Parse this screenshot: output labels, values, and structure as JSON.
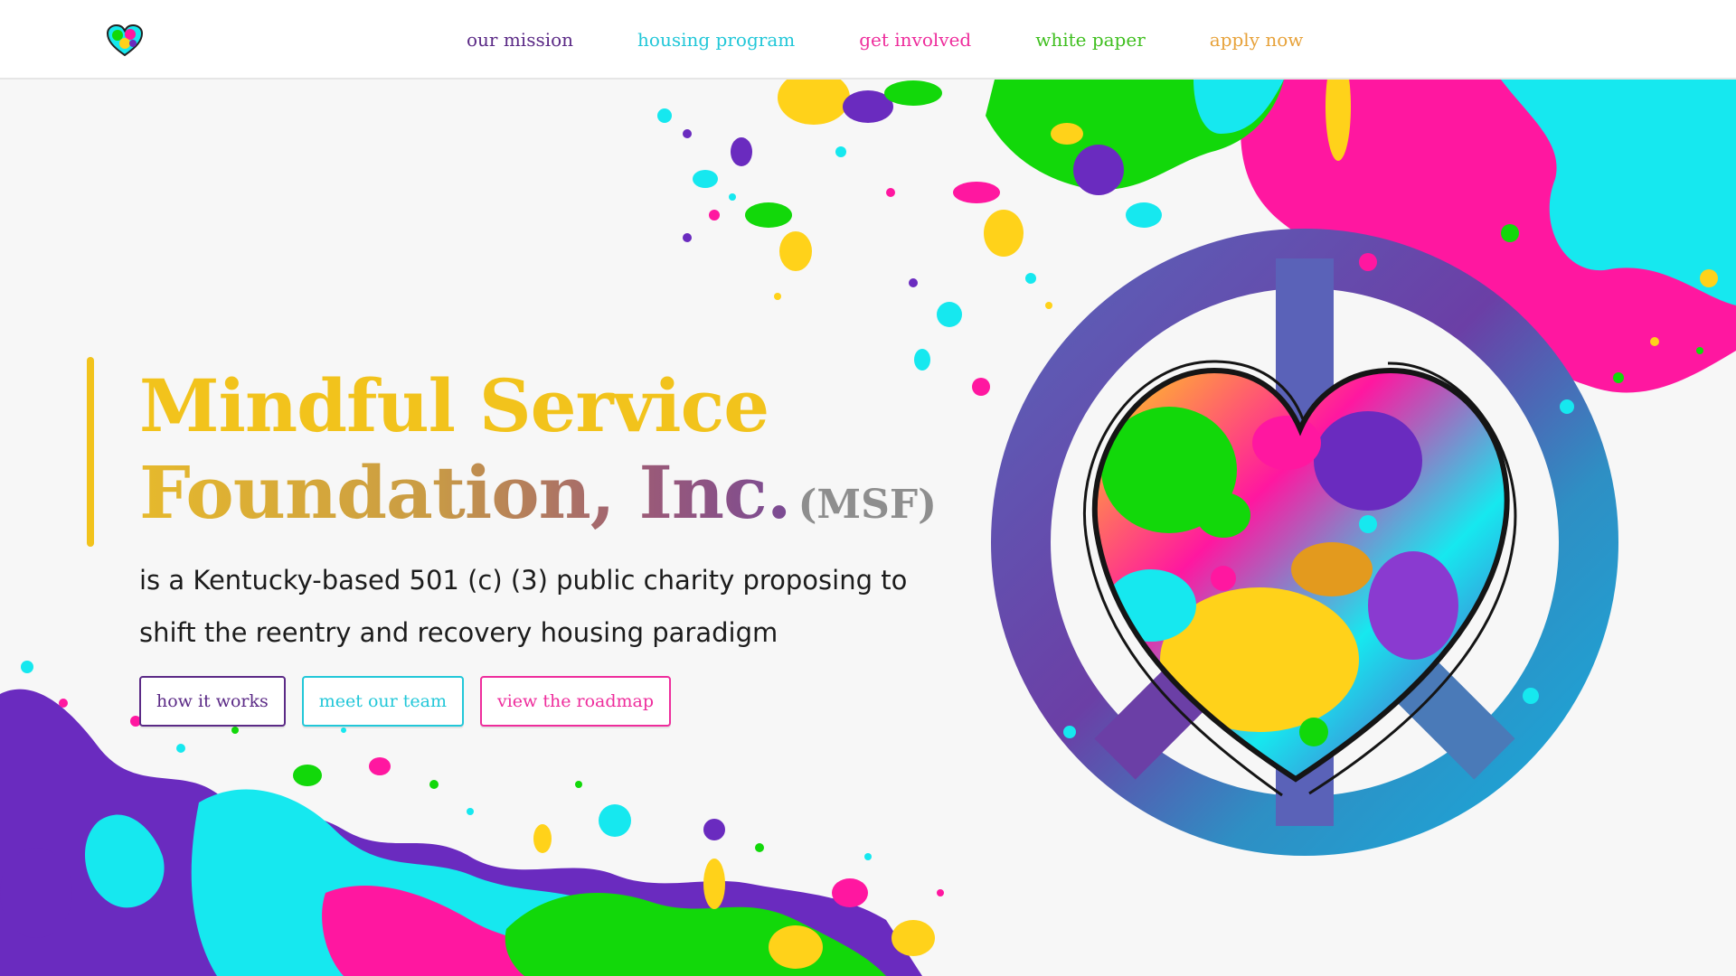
{
  "header": {
    "logo_icon": "heart-logo-icon",
    "nav": [
      {
        "label": "our mission",
        "color": "#5b2a86"
      },
      {
        "label": "housing program",
        "color": "#22c7d8"
      },
      {
        "label": "get involved",
        "color": "#ee2d9c"
      },
      {
        "label": "white paper",
        "color": "#3fbf1f"
      },
      {
        "label": "apply now",
        "color": "#e7a23a"
      }
    ]
  },
  "hero": {
    "title_line1": "Mindful Service",
    "title_line2": "Foundation, Inc.",
    "title_abbr": "(MSF)",
    "description": "is a Kentucky-based 501 (c) (3) public charity proposing to shift the reentry and recovery housing paradigm",
    "buttons": [
      {
        "label": "how it works",
        "color": "#5b2a86"
      },
      {
        "label": "meet our team",
        "color": "#22c7d8"
      },
      {
        "label": "view the roadmap",
        "color": "#ee2d9c"
      }
    ]
  },
  "illustration": {
    "icon": "peace-heart-icon",
    "colors": [
      "#6a2bbf",
      "#16e8ef",
      "#ff17a0",
      "#12d80a",
      "#ffd21a",
      "#e39a1e"
    ]
  },
  "theme": {
    "accent": "#f2c31c",
    "background": "#f7f7f7"
  }
}
